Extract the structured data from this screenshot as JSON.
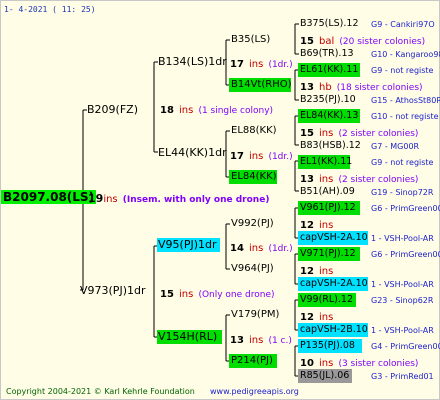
{
  "header": {
    "date": "1-  4-2021  ( 11: 25)"
  },
  "root": {
    "name": "B2097.08(LS)",
    "ins_num": "19",
    "ins_word": "ins",
    "note": "(Insem. with only one drone)"
  },
  "level1": [
    {
      "name": "B209(FZ)",
      "ins_num": "18",
      "ins_word": "ins",
      "note": "(1 single colony)"
    },
    {
      "name": "V973(PJ)1dr",
      "ins_num": "15",
      "ins_word": "ins",
      "note": "(Only one drone)"
    }
  ],
  "level2": [
    {
      "name": "B134(LS)1dr",
      "ins_num": "17",
      "ins_word": "ins",
      "note": "(1dr.)"
    },
    {
      "name": "EL44(KK)1dr",
      "ins_num": "17",
      "ins_word": "ins",
      "note": "(1dr.)"
    },
    {
      "name": "V95(PJ)1dr",
      "ins_num": "14",
      "ins_word": "ins",
      "note": "(1dr.)"
    },
    {
      "name": "V154H(RL)",
      "ins_num": "13",
      "ins_word": "ins",
      "note": "(1 c.)"
    }
  ],
  "level3": [
    {
      "name": "B35(LS)"
    },
    {
      "name": "B14Vt(RHO)"
    },
    {
      "name": "EL88(KK)"
    },
    {
      "name": "EL84(KK)"
    },
    {
      "name": "V992(PJ)"
    },
    {
      "name": "V964(PJ)"
    },
    {
      "name": "V179(PM)"
    },
    {
      "name": "P214(PJ)"
    }
  ],
  "level4": [
    {
      "name": "B375(LS).12",
      "info": "G9 - Cankiri97O"
    },
    {
      "ins_num": "15",
      "ins_word": "bal",
      "note": "(20 sister colonies)"
    },
    {
      "name": "B69(TR).13",
      "info": "G10 - Kangaroo98R"
    },
    {
      "name": "EL61(KK).11",
      "info": "G9 - not registe"
    },
    {
      "ins_num": "13",
      "ins_word": "hb",
      "note": "(18 sister colonies)"
    },
    {
      "name": "B235(PJ).10",
      "info": "G15 - AthosSt80R"
    },
    {
      "name": "EL84(KK).13",
      "info": "G10 - not registe"
    },
    {
      "ins_num": "15",
      "ins_word": "ins",
      "note": "(2 sister colonies)"
    },
    {
      "name": "B83(HSB).12",
      "info": "G7 - MG00R"
    },
    {
      "name": "EL1(KK).11",
      "info": "G9 - not registe"
    },
    {
      "ins_num": "13",
      "ins_word": "ins",
      "note": "(2 sister colonies)"
    },
    {
      "name": "B51(AH).09",
      "info": "G19 - Sinop72R"
    },
    {
      "name": "V961(PJ).12",
      "info": "G6 - PrimGreen00"
    },
    {
      "ins_num": "12",
      "ins_word": "ins",
      "note": ""
    },
    {
      "name": "capVSH-2A.10",
      "info": "1 - VSH-Pool-AR"
    },
    {
      "name": "V971(PJ).12",
      "info": "G6 - PrimGreen00"
    },
    {
      "ins_num": "12",
      "ins_word": "ins",
      "note": ""
    },
    {
      "name": "capVSH-2A.10",
      "info": "1 - VSH-Pool-AR"
    },
    {
      "name": "V99(RL).12",
      "info": "G23 - Sinop62R"
    },
    {
      "ins_num": "12",
      "ins_word": "ins",
      "note": ""
    },
    {
      "name": "capVSH-2B.10",
      "info": "1 - VSH-Pool-AR"
    },
    {
      "name": "P135(PJ).08",
      "info": "G4 - PrimGreen00"
    },
    {
      "ins_num": "10",
      "ins_word": "ins",
      "note": "(3 sister colonies)"
    },
    {
      "name": "R85(JL).06",
      "info": "G3 - PrimRed01"
    }
  ],
  "footer": {
    "copyright": "Copyright 2004-2021 © Karl Kehrle Foundation",
    "url": "www.pedigreeapis.org"
  },
  "colors": {
    "background": "#fffde6",
    "green_highlight": "#00dd00",
    "cyan_highlight": "#00e0ff",
    "ins_red": "#c00000",
    "note_purple": "#8000ff",
    "info_blue": "#1e22cc"
  }
}
